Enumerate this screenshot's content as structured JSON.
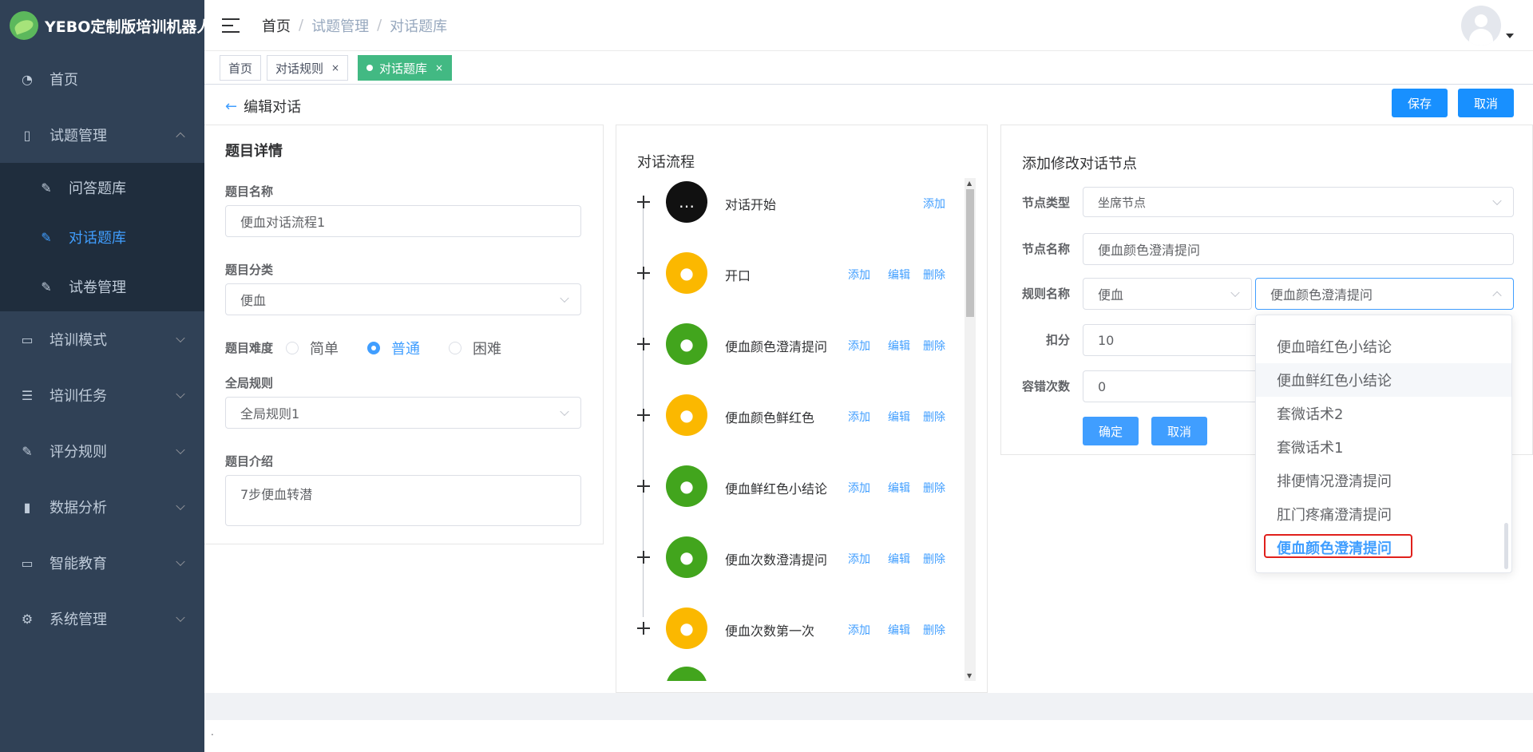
{
  "app": {
    "title": "YEBO定制版培训机器人"
  },
  "sidebar": {
    "items": [
      {
        "label": "首页",
        "icon": "dashboard-icon"
      },
      {
        "label": "试题管理",
        "icon": "book-icon"
      },
      {
        "label": "培训模式",
        "icon": "monitor-icon"
      },
      {
        "label": "培训任务",
        "icon": "list-icon"
      },
      {
        "label": "评分规则",
        "icon": "edit-icon"
      },
      {
        "label": "数据分析",
        "icon": "bar-chart-icon"
      },
      {
        "label": "智能教育",
        "icon": "screen-chart-icon"
      },
      {
        "label": "系统管理",
        "icon": "gear-icon"
      }
    ],
    "sub": [
      {
        "label": "问答题库",
        "icon": "edit-icon"
      },
      {
        "label": "对话题库",
        "icon": "edit-icon"
      },
      {
        "label": "试卷管理",
        "icon": "edit-icon"
      }
    ]
  },
  "breadcrumb": [
    "首页",
    "试题管理",
    "对话题库"
  ],
  "tags": [
    {
      "label": "首页"
    },
    {
      "label": "对话规则"
    },
    {
      "label": "对话题库"
    }
  ],
  "page": {
    "back_label": "编辑对话",
    "save": "保存",
    "cancel": "取消"
  },
  "details": {
    "title": "题目详情",
    "name_label": "题目名称",
    "name_value": "便血对话流程1",
    "category_label": "题目分类",
    "category_value": "便血",
    "difficulty_label": "题目难度",
    "difficulty_options": [
      "简单",
      "普通",
      "困难"
    ],
    "difficulty_selected": "普通",
    "global_rule_label": "全局规则",
    "global_rule_value": "全局规则1",
    "intro_label": "题目介绍",
    "intro_value": "7步便血转潜"
  },
  "flow": {
    "title": "对话流程",
    "actions": {
      "add": "添加",
      "edit": "编辑",
      "delete": "删除"
    },
    "nodes": [
      {
        "name": "对话开始",
        "color": "black"
      },
      {
        "name": "开口",
        "color": "yellow"
      },
      {
        "name": "便血颜色澄清提问",
        "color": "green"
      },
      {
        "name": "便血颜色鲜红色",
        "color": "yellow"
      },
      {
        "name": "便血鲜红色小结论",
        "color": "green"
      },
      {
        "name": "便血次数澄清提问",
        "color": "green"
      },
      {
        "name": "便血次数第一次",
        "color": "yellow"
      }
    ]
  },
  "node_form": {
    "title": "添加修改对话节点",
    "type_label": "节点类型",
    "type_value": "坐席节点",
    "name_label": "节点名称",
    "name_value": "便血颜色澄清提问",
    "rule_label": "规则名称",
    "rule_category": "便血",
    "rule_value": "便血颜色澄清提问",
    "score_label": "扣分",
    "score_value": "10",
    "tolerance_label": "容错次数",
    "tolerance_value": "0",
    "confirm": "确定",
    "cancel": "取消"
  },
  "dropdown": {
    "options": [
      "便血暗红色小结论",
      "便血鲜红色小结论",
      "套微话术2",
      "套微话术1",
      "排便情况澄清提问",
      "肛门疼痛澄清提问",
      "便血颜色澄清提问"
    ],
    "hovered": "便血鲜红色小结论",
    "selected": "便血颜色澄清提问"
  },
  "footer": {
    "text": "."
  }
}
